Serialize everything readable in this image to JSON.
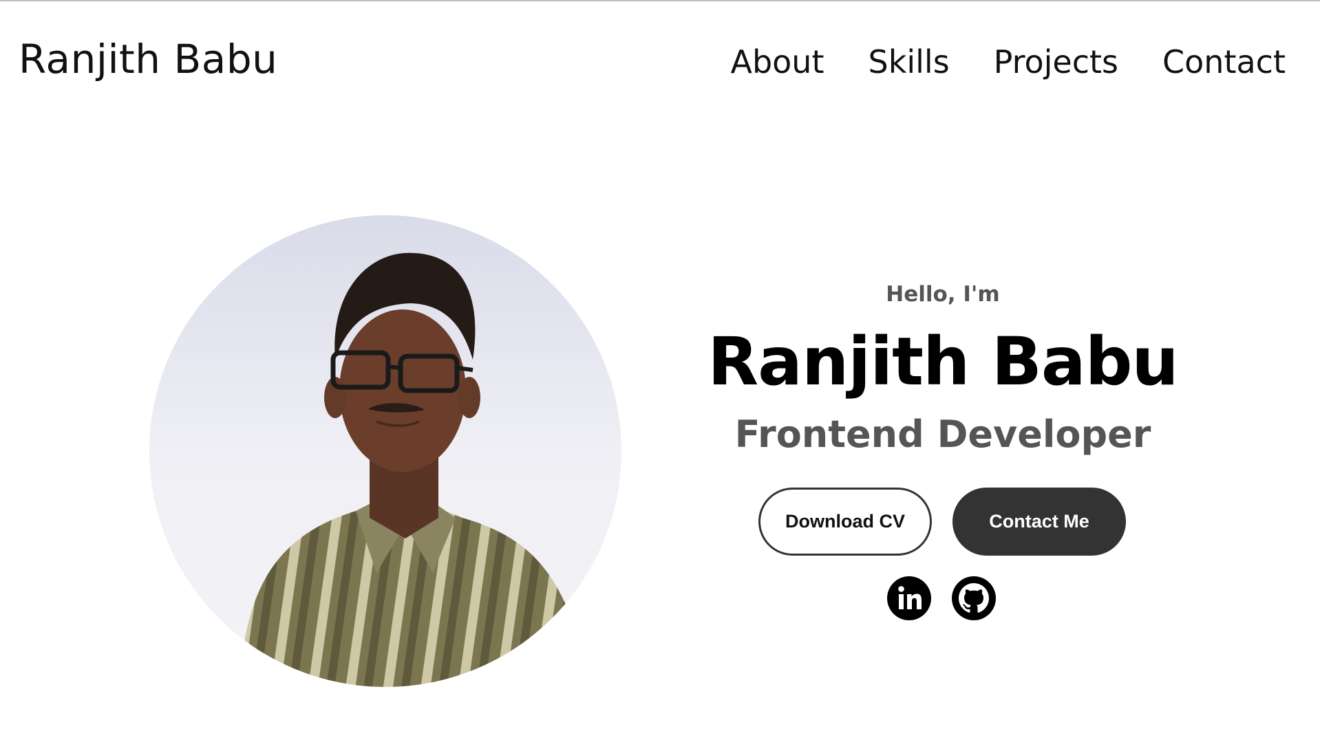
{
  "header": {
    "logo": "Ranjith Babu",
    "nav": [
      "About",
      "Skills",
      "Projects",
      "Contact"
    ]
  },
  "hero": {
    "greeting": "Hello, I'm",
    "name": "Ranjith Babu",
    "role": "Frontend Developer",
    "buttons": {
      "download_cv": "Download CV",
      "contact_me": "Contact Me"
    },
    "social_icons": [
      "linkedin-icon",
      "github-icon"
    ]
  },
  "colors": {
    "text": "#111111",
    "muted": "#555555",
    "button_dark": "#333333",
    "background": "#ffffff"
  }
}
